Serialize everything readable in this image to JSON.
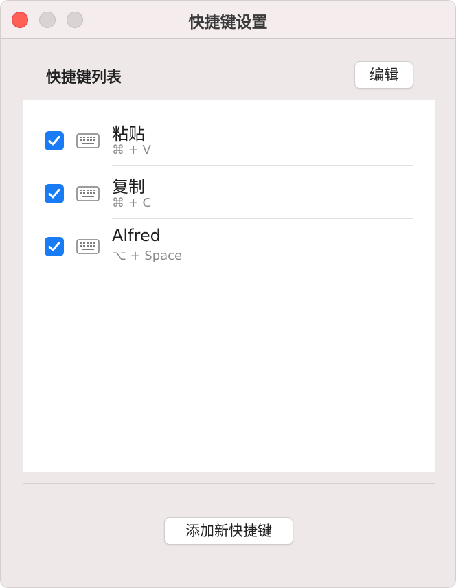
{
  "window": {
    "title": "快捷键设置",
    "controls": [
      "close-icon",
      "minimize-icon",
      "zoom-icon"
    ]
  },
  "header": {
    "section_title": "快捷键列表",
    "edit_label": "编辑"
  },
  "shortcuts": [
    {
      "name": "粘贴",
      "combo": "⌘ + V",
      "enabled": true,
      "icon": "keyboard-icon"
    },
    {
      "name": "复制",
      "combo": "⌘ + C",
      "enabled": true,
      "icon": "keyboard-icon"
    },
    {
      "name": "Alfred",
      "combo": "⌥ + Space",
      "enabled": true,
      "icon": "keyboard-icon"
    }
  ],
  "footer": {
    "add_label": "添加新快捷键"
  },
  "colors": {
    "accent": "#1a7cf5",
    "close": "#fe5f57",
    "window_bg": "#efe8e8"
  }
}
